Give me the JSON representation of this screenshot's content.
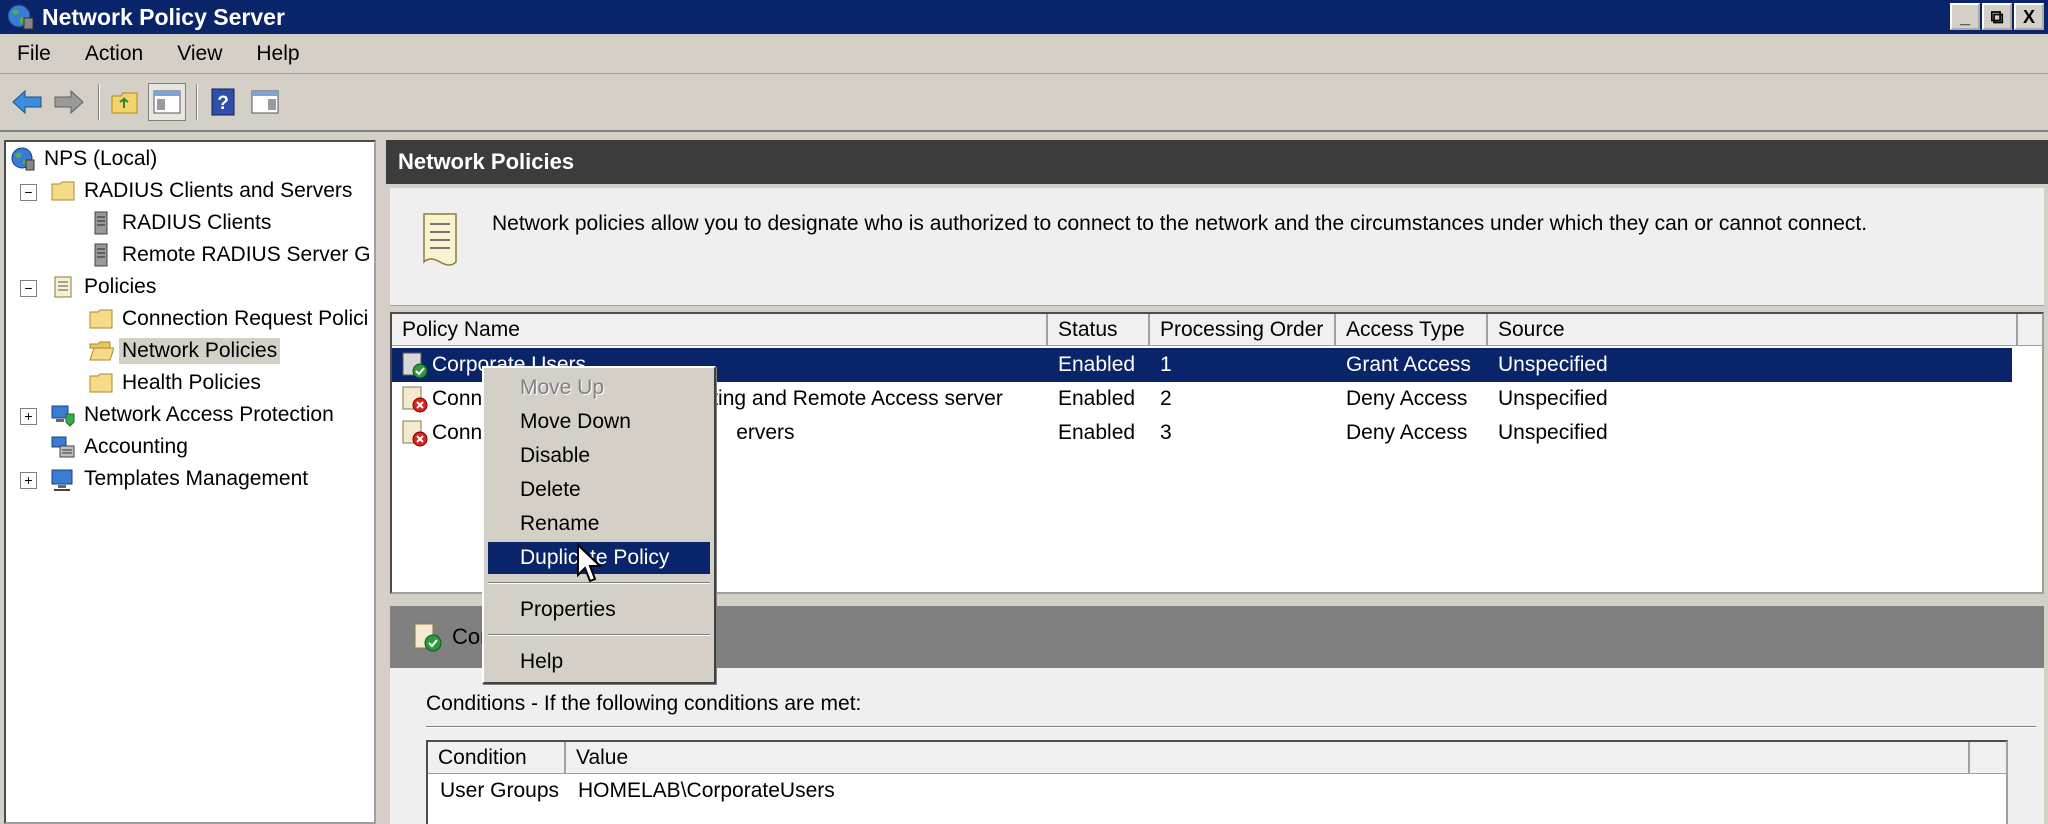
{
  "window": {
    "title": "Network Policy Server",
    "controls": [
      "_",
      "⧉",
      "X"
    ]
  },
  "menubar": [
    "File",
    "Action",
    "View",
    "Help"
  ],
  "toolbar_icons": [
    "back-arrow-icon",
    "forward-arrow-icon",
    "up-folder-icon",
    "show-hide-tree-icon",
    "help-icon",
    "show-hide-action-pane-icon"
  ],
  "tree": {
    "root": "NPS (Local)",
    "radius_group": "RADIUS Clients and Servers",
    "radius_clients": "RADIUS Clients",
    "remote_radius": "Remote RADIUS Server G",
    "policies": "Policies",
    "connection_request": "Connection Request Polici",
    "network_policies": "Network Policies",
    "health_policies": "Health Policies",
    "nap": "Network Access Protection",
    "accounting": "Accounting",
    "templates": "Templates Management",
    "expand_minus": "−",
    "expand_plus": "+"
  },
  "main": {
    "header": "Network Policies",
    "description": "Network policies allow you to designate who is authorized to connect to the network and the circumstances under which they can or cannot connect.",
    "columns": [
      "Policy Name",
      "Status",
      "Processing Order",
      "Access Type",
      "Source"
    ],
    "rows": [
      {
        "name": "Corporate Users",
        "status": "Enabled",
        "order": "1",
        "access": "Grant Access",
        "source": "Unspecified"
      },
      {
        "name": "Conn",
        "name_tail": "ting and Remote Access server",
        "status": "Enabled",
        "order": "2",
        "access": "Deny Access",
        "source": "Unspecified"
      },
      {
        "name": "Conn",
        "name_tail": "ervers",
        "status": "Enabled",
        "order": "3",
        "access": "Deny Access",
        "source": "Unspecified"
      }
    ]
  },
  "detail": {
    "header": "Cor",
    "conditions_label": "Conditions - If the following conditions are met:",
    "columns": [
      "Condition",
      "Value"
    ],
    "rows": [
      {
        "condition": "User Groups",
        "value": "HOMELAB\\CorporateUsers"
      }
    ]
  },
  "context_menu": {
    "move_up": "Move Up",
    "move_down": "Move Down",
    "disable": "Disable",
    "delete": "Delete",
    "rename": "Rename",
    "duplicate": "Duplicate Policy",
    "properties": "Properties",
    "help": "Help"
  },
  "colors": {
    "titlebar": "#0a246a",
    "selection": "#0a246a",
    "chrome": "#d4d0c8",
    "header_dark": "#3c3c3c"
  }
}
